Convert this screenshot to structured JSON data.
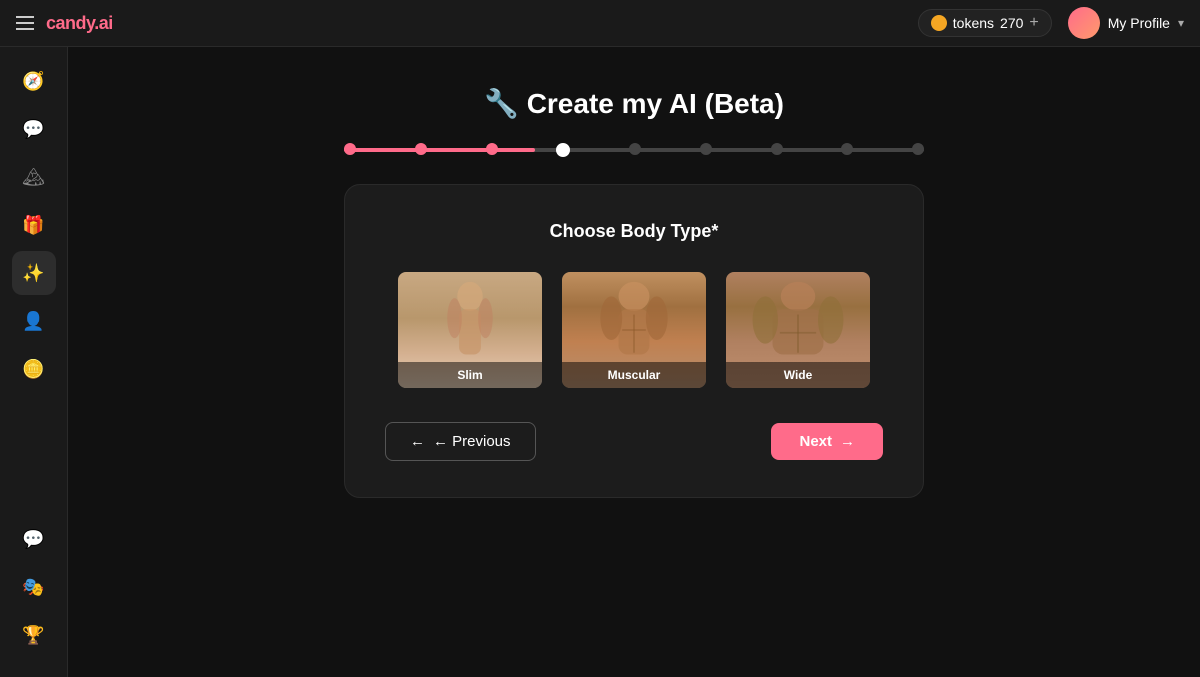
{
  "topnav": {
    "menu_icon": "☰",
    "logo_text": "candy",
    "logo_dot": ".",
    "logo_ai": "ai",
    "tokens_label": "tokens",
    "tokens_count": "270",
    "tokens_plus": "+",
    "profile_label": "My Profile",
    "profile_chevron": "▾"
  },
  "sidebar": {
    "items": [
      {
        "icon": "🧭",
        "name": "explore",
        "label": "Explore"
      },
      {
        "icon": "💬",
        "name": "chat",
        "label": "Chat"
      },
      {
        "icon": "🏔",
        "name": "feed",
        "label": "Feed"
      },
      {
        "icon": "🎁",
        "name": "gifts",
        "label": "Gifts"
      },
      {
        "icon": "✨",
        "name": "create",
        "label": "Create",
        "active": true
      },
      {
        "icon": "👤",
        "name": "profile",
        "label": "Profile"
      },
      {
        "icon": "🪙",
        "name": "coins",
        "label": "Coins",
        "coin": true
      }
    ],
    "bottom_items": [
      {
        "icon": "💬",
        "name": "discord",
        "label": "Discord"
      },
      {
        "icon": "🎭",
        "name": "referral",
        "label": "Referral"
      },
      {
        "icon": "🏆",
        "name": "leaderboard",
        "label": "Leaderboard"
      }
    ]
  },
  "page": {
    "title": "🔧 Create my AI (Beta)",
    "progress": {
      "total_steps": 9,
      "completed_steps": 3,
      "current_step": 4
    },
    "card": {
      "title": "Choose Body Type*",
      "body_types": [
        {
          "id": "slim",
          "label": "Slim"
        },
        {
          "id": "muscular",
          "label": "Muscular"
        },
        {
          "id": "wide",
          "label": "Wide"
        }
      ],
      "selected": null,
      "prev_button": "← Previous",
      "next_button": "Next →"
    }
  }
}
